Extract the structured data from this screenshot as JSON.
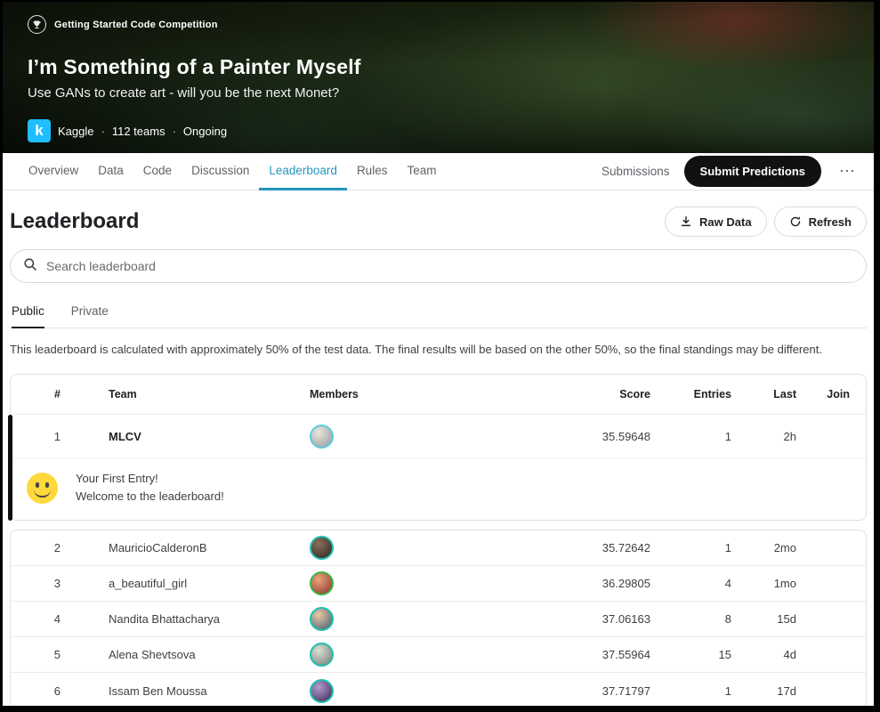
{
  "colors": {
    "brand_blue": "#20beff",
    "active_tab_blue": "#2596be",
    "submit_button_bg": "#111111",
    "first_entry_bar": "#0d0d0d",
    "smiley_yellow": "#ffd83a"
  },
  "banner": {
    "category": "Getting Started Code Competition",
    "title": "I’m Something of a Painter Myself",
    "subtitle": "Use GANs to create art - will you be the next Monet?",
    "org": "Kaggle",
    "logo_letter": "k",
    "separator": "·",
    "teams": "112 teams",
    "status": "Ongoing"
  },
  "nav": {
    "tabs": [
      "Overview",
      "Data",
      "Code",
      "Discussion",
      "Leaderboard",
      "Rules",
      "Team"
    ],
    "active_tab": "Leaderboard",
    "submissions_label": "Submissions",
    "submit_button_label": "Submit Predictions",
    "more_label": "⋯"
  },
  "leaderboard": {
    "title": "Leaderboard",
    "raw_data_button": "Raw Data",
    "refresh_button": "Refresh",
    "search_placeholder": "Search leaderboard",
    "tabs": [
      "Public",
      "Private"
    ],
    "active_view_tab": "Public",
    "description": "This leaderboard is calculated with approximately 50% of the test data. The final results will be based on the other 50%, so the final standings may be different.",
    "columns": [
      "#",
      "Team",
      "Members",
      "Score",
      "Entries",
      "Last",
      "Join"
    ],
    "first_entry_callout": {
      "line1": "Your First Entry!",
      "line2": "Welcome to the leaderboard!"
    },
    "rows": [
      {
        "rank": "1",
        "team": "MLCV",
        "score": "35.59648",
        "entries": "1",
        "last": "2h",
        "join": "",
        "avatar_colors": [
          "#ece7db",
          "#8e9a9e"
        ],
        "avatar_ring": "#5fcbe0"
      },
      {
        "rank": "2",
        "team": "MauricioCalderonB",
        "score": "35.72642",
        "entries": "1",
        "last": "2mo",
        "join": "",
        "avatar_colors": [
          "#8a6f5a",
          "#2a2420"
        ],
        "avatar_ring": "#1ebfb0"
      },
      {
        "rank": "3",
        "team": "a_beautiful_girl",
        "score": "36.29805",
        "entries": "4",
        "last": "1mo",
        "join": "",
        "avatar_colors": [
          "#eda47c",
          "#84352a"
        ],
        "avatar_ring": "#3cb54a"
      },
      {
        "rank": "4",
        "team": "Nandita Bhattacharya",
        "score": "37.06163",
        "entries": "8",
        "last": "15d",
        "join": "",
        "avatar_colors": [
          "#ecc9a8",
          "#3c5d6d"
        ],
        "avatar_ring": "#1ebfb0"
      },
      {
        "rank": "5",
        "team": "Alena Shevtsova",
        "score": "37.55964",
        "entries": "15",
        "last": "4d",
        "join": "",
        "avatar_colors": [
          "#dfdfd6",
          "#6c7d74"
        ],
        "avatar_ring": "#1ebfb0"
      },
      {
        "rank": "6",
        "team": "Issam Ben Moussa",
        "score": "37.71797",
        "entries": "1",
        "last": "17d",
        "join": "",
        "avatar_colors": [
          "#b29bd2",
          "#3a2a4a"
        ],
        "avatar_ring": "#1ebfb0"
      }
    ]
  }
}
